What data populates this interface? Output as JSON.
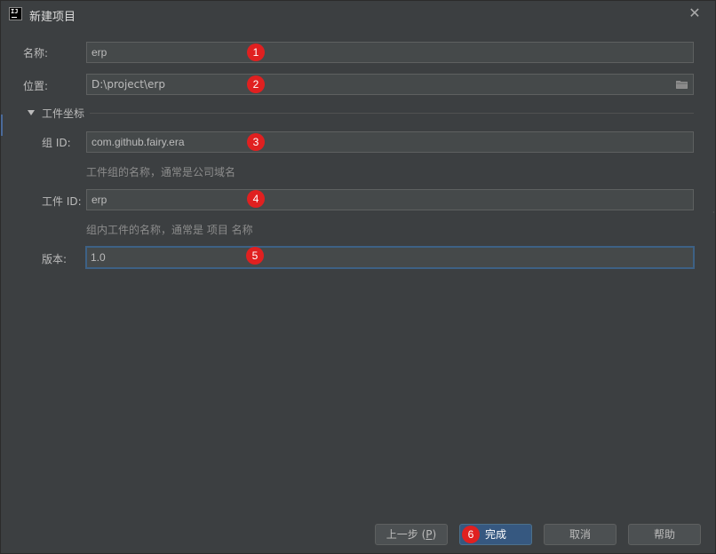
{
  "window": {
    "title": "新建项目",
    "logo_text": "IJ",
    "close_glyph": "✕"
  },
  "form": {
    "name": {
      "label": "名称:",
      "value": "erp",
      "badge": "1"
    },
    "location": {
      "label": "位置:",
      "value": "D:\\project\\erp",
      "badge": "2",
      "icon": "folder-icon"
    },
    "artifact_coords": {
      "title": "工件坐标",
      "expanded": true
    },
    "group_id": {
      "label": "组 ID:",
      "value": "com.github.fairy.era",
      "hint": "工件组的名称，通常是公司域名",
      "badge": "3"
    },
    "artifact_id": {
      "label": "工件 ID:",
      "value": "erp",
      "hint": "组内工件的名称，通常是 项目 名称",
      "badge": "4"
    },
    "version": {
      "label": "版本:",
      "value": "1.0",
      "badge": "5"
    }
  },
  "footer": {
    "prev_label": "上一步 (",
    "prev_mnemonic": "P",
    "prev_suffix": ")",
    "finish_label": "完成",
    "finish_badge": "6",
    "cancel_label": "取消",
    "help_label": "帮助"
  },
  "colors": {
    "background": "#3c3f41",
    "field_bg": "#45494a",
    "badge": "#e02020",
    "primary_button": "#365880",
    "focus_border": "#3d6185"
  }
}
